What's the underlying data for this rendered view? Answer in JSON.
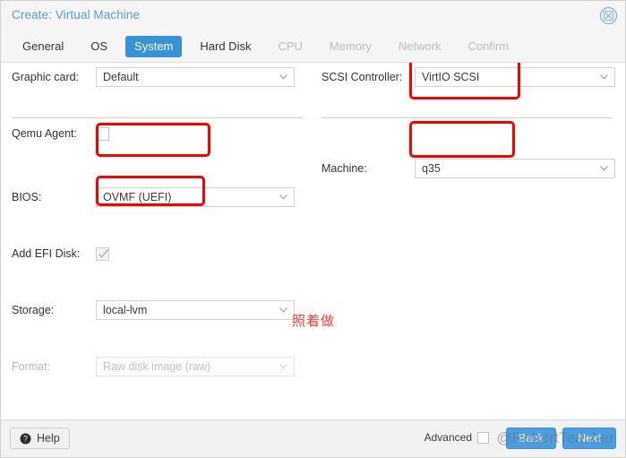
{
  "window": {
    "title": "Create: Virtual Machine",
    "close_icon": "close-circle-icon"
  },
  "tabs": [
    {
      "label": "General",
      "state": "enabled"
    },
    {
      "label": "OS",
      "state": "enabled"
    },
    {
      "label": "System",
      "state": "active"
    },
    {
      "label": "Hard Disk",
      "state": "enabled"
    },
    {
      "label": "CPU",
      "state": "disabled"
    },
    {
      "label": "Memory",
      "state": "disabled"
    },
    {
      "label": "Network",
      "state": "disabled"
    },
    {
      "label": "Confirm",
      "state": "disabled"
    }
  ],
  "form": {
    "left": {
      "graphic_card": {
        "label": "Graphic card:",
        "value": "Default"
      },
      "qemu_agent": {
        "label": "Qemu Agent:",
        "checked": false
      },
      "bios": {
        "label": "BIOS:",
        "value": "OVMF (UEFI)"
      },
      "add_efi_disk": {
        "label": "Add EFI Disk:",
        "checked": true
      },
      "storage": {
        "label": "Storage:",
        "value": "local-lvm"
      },
      "format": {
        "label": "Format:",
        "value": "Raw disk image (raw)",
        "disabled": true
      }
    },
    "right": {
      "scsi_controller": {
        "label": "SCSI Controller:",
        "value": "VirtIO SCSI"
      },
      "machine": {
        "label": "Machine:",
        "value": "q35"
      }
    }
  },
  "annotation": {
    "note_text": "照着做",
    "note_color": "#fb3b3b",
    "highlight_color": "#fb0000",
    "highlighted_fields": [
      "scsi_controller",
      "bios",
      "machine",
      "storage"
    ]
  },
  "footer": {
    "help_label": "Help",
    "help_icon": "question-mark-icon",
    "advanced_label": "Advanced",
    "advanced_checked": false,
    "back_label": "Back",
    "next_label": "Next"
  },
  "watermark": {
    "text": "@RobertTeacher"
  }
}
